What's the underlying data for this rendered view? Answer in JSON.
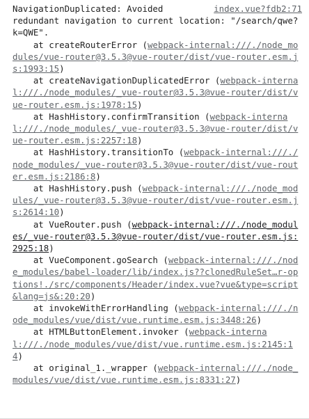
{
  "console": {
    "source_link": "index.vue?fdb2:71",
    "message_line1": "NavigationDuplicated: Avoided",
    "message_rest": "redundant navigation to current location: \"/search/qwe?k=QWE\".",
    "frames": [
      {
        "at": "    at createRouterError (",
        "link": "webpack-internal:///./node_modules/vue-router@3.5.3@vue-router/dist/vue-router.esm.js:1993:15",
        "close": ")"
      },
      {
        "at": "    at createNavigationDuplicatedError (",
        "link": "webpack-internal:///./node_modules/_vue-router@3.5.3@vue-router/dist/vue-router.esm.js:1978:15",
        "close": ")"
      },
      {
        "at": "    at HashHistory.confirmTransition (",
        "link": "webpack-internal:///./node_modules/_vue-router@3.5.3@vue-router/dist/vue-router.esm.js:2257:18",
        "close": ")"
      },
      {
        "at": "    at HashHistory.transitionTo (",
        "link": "webpack-internal:///./node_modules/_vue-router@3.5.3@vue-router/dist/vue-router.esm.js:2186:8",
        "close": ")"
      },
      {
        "at": "    at HashHistory.push (",
        "link": "webpack-internal:///./node_modules/_vue-router@3.5.3@vue-router/dist/vue-router.esm.js:2614:10",
        "close": ")"
      },
      {
        "at": "    at VueRouter.push (",
        "link": "webpack-internal:///./node_modules/_vue-router@3.5.3@vue-router/dist/vue-router.esm.js:2925:18",
        "close": ")"
      },
      {
        "at": "    at VueComponent.goSearch (",
        "link": "webpack-internal:///./node_modules/babel-loader/lib/index.js??clonedRuleSet…r-options!./src/components/Header/index.vue?vue&type=script&lang=js&:20:20",
        "close": ")"
      },
      {
        "at": "    at invokeWithErrorHandling (",
        "link": "webpack-internal:///./node_modules/vue/dist/vue.runtime.esm.js:3448:26",
        "close": ")"
      },
      {
        "at": "    at HTMLButtonElement.invoker (",
        "link": "webpack-internal:///./node_modules/vue/dist/vue.runtime.esm.js:2145:14",
        "close": ")"
      },
      {
        "at": "    at original_1._wrapper (",
        "link": "webpack-internal:///./node_modules/vue/dist/vue.runtime.esm.js:8331:27",
        "close": ")"
      }
    ]
  }
}
